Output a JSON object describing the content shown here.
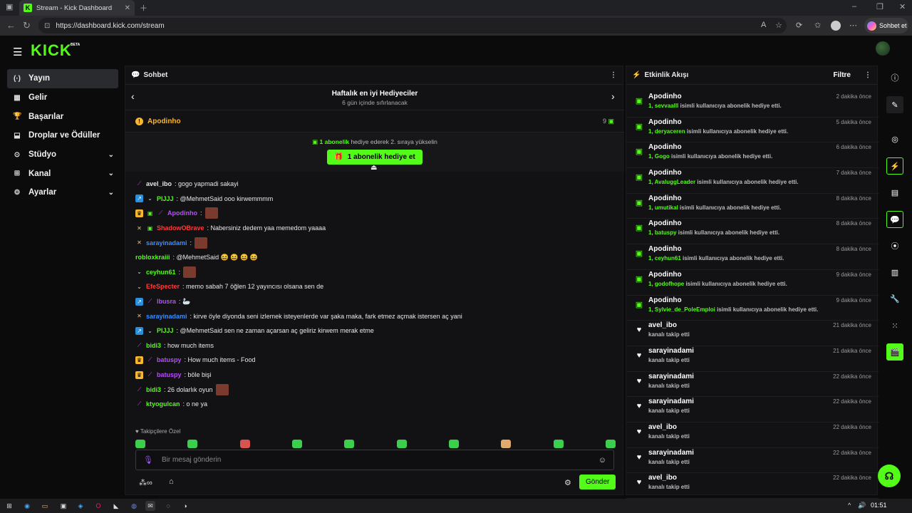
{
  "browser": {
    "tab_title": "Stream - Kick Dashboard",
    "tab_favicon": "K",
    "url": "https://dashboard.kick.com/stream",
    "copilot_label": "Sohbet et"
  },
  "app": {
    "logo": "KICK",
    "logo_badge": "BETA"
  },
  "sidebar": {
    "items": [
      {
        "label": "Yayın",
        "icon": "broadcast-icon",
        "glyph": "(·)"
      },
      {
        "label": "Gelir",
        "icon": "revenue-icon",
        "glyph": "▦"
      },
      {
        "label": "Başarılar",
        "icon": "trophy-icon",
        "glyph": "🏆"
      },
      {
        "label": "Droplar ve Ödüller",
        "icon": "drops-icon",
        "glyph": "⬓"
      },
      {
        "label": "Stüdyo",
        "icon": "studio-icon",
        "glyph": "⊙"
      },
      {
        "label": "Kanal",
        "icon": "channel-icon",
        "glyph": "⊞"
      },
      {
        "label": "Ayarlar",
        "icon": "settings-icon",
        "glyph": "⚙"
      }
    ]
  },
  "chat": {
    "title": "Sohbet",
    "leaderboard_title": "Haftalık en iyi Hediyeciler",
    "leaderboard_sub": "6 gün içinde sıfırlanacak",
    "top_gifter": "Apodinho",
    "top_gifter_count": "9",
    "promo_bold": "1 abonelik",
    "promo_rest": " hediye ederek 2. sıraya yükselin",
    "promo_button": "1 abonelik hediye et",
    "messages": [
      {
        "user": "avel_ibo",
        "color": "#e8e8e8",
        "text": ": gogo yapmadi sakayi",
        "badges": [
          "sword"
        ]
      },
      {
        "user": "PIJJJ",
        "color": "#53fc18",
        "text": ": @MehmetSaid ooo kirwemmmm",
        "badges": [
          "verified",
          "chev"
        ]
      },
      {
        "user": "Apodinho",
        "color": "#b84cff",
        "text": ":",
        "badges": [
          "crown",
          "gift",
          "sword"
        ],
        "emote": true
      },
      {
        "user": "ShadowOBrave",
        "color": "#ff3a3a",
        "text": ": Nabersiniz dedem yaa memedom yaaaa",
        "badges": [
          "swords",
          "gift"
        ]
      },
      {
        "user": "sarayinadami",
        "color": "#3a8dff",
        "text": ":",
        "badges": [
          "swords"
        ],
        "emote": true
      },
      {
        "user": "robloxkraiii",
        "color": "#53fc18",
        "text": ": @MehmetSaid 😆 😆 😆 😆",
        "badges": []
      },
      {
        "user": "ceyhun61",
        "color": "#53fc18",
        "text": ":",
        "badges": [
          "chev"
        ],
        "emote": true
      },
      {
        "user": "EfeSpecter",
        "color": "#ff3a3a",
        "text": ": memo sabah 7 öğlen 12 yayıncısı olsana sen de",
        "badges": [
          "chev"
        ]
      },
      {
        "user": "lbusra",
        "color": "#b84cff",
        "text": ": 🦢",
        "badges": [
          "verified",
          "sword"
        ]
      },
      {
        "user": "sarayinadami",
        "color": "#3a8dff",
        "text": ": kirve öyle diyonda seni izlemek isteyenlerde var şaka maka, fark etmez açmak istersen aç yani",
        "badges": [
          "swords"
        ]
      },
      {
        "user": "PIJJJ",
        "color": "#53fc18",
        "text": ": @MehmetSaid sen ne zaman açarsan aç geliriz kirwem merak etme",
        "badges": [
          "verified",
          "chev"
        ]
      },
      {
        "user": "bidi3",
        "color": "#53fc18",
        "text": ": how much items",
        "badges": [
          "sword"
        ]
      },
      {
        "user": "batuspy",
        "color": "#b84cff",
        "text": ": How much items - Food",
        "badges": [
          "crown",
          "sword"
        ]
      },
      {
        "user": "batuspy",
        "color": "#b84cff",
        "text": ": böle bişi",
        "badges": [
          "crown",
          "sword"
        ]
      },
      {
        "user": "bidi3",
        "color": "#53fc18",
        "text": ": 26 dolarlık oyun",
        "badges": [
          "sword"
        ],
        "emote": true
      },
      {
        "user": "ktyogulcan",
        "color": "#53fc18",
        "text": ": o ne ya",
        "badges": [
          "sword"
        ]
      }
    ],
    "emote_label": "Takipçilere Özel",
    "input_placeholder": "Bir mesaj gönderin",
    "send_button": "Gönder"
  },
  "activity": {
    "title": "Etkinlik Akışı",
    "filter_label": "Filtre",
    "items": [
      {
        "name": "Apodinho",
        "type": "gift",
        "prefix": "1, ",
        "target": "sevvaalll",
        "rest": " isimli kullanıcıya abonelik hediye etti.",
        "time": "2 dakika önce"
      },
      {
        "name": "Apodinho",
        "type": "gift",
        "prefix": "1, ",
        "target": "deryaceren",
        "rest": " isimli kullanıcıya abonelik hediye etti.",
        "time": "5 dakika önce"
      },
      {
        "name": "Apodinho",
        "type": "gift",
        "prefix": "1, ",
        "target": "Gogo",
        "rest": " isimli kullanıcıya abonelik hediye etti.",
        "time": "6 dakika önce"
      },
      {
        "name": "Apodinho",
        "type": "gift",
        "prefix": "1, ",
        "target": "AvaluggLeader",
        "rest": " isimli kullanıcıya abonelik hediye etti.",
        "time": "7 dakika önce"
      },
      {
        "name": "Apodinho",
        "type": "gift",
        "prefix": "1, ",
        "target": "umutikal",
        "rest": " isimli kullanıcıya abonelik hediye etti.",
        "time": "8 dakika önce"
      },
      {
        "name": "Apodinho",
        "type": "gift",
        "prefix": "1, ",
        "target": "batuspy",
        "rest": " isimli kullanıcıya abonelik hediye etti.",
        "time": "8 dakika önce"
      },
      {
        "name": "Apodinho",
        "type": "gift",
        "prefix": "1, ",
        "target": "ceyhun61",
        "rest": " isimli kullanıcıya abonelik hediye etti.",
        "time": "8 dakika önce"
      },
      {
        "name": "Apodinho",
        "type": "gift",
        "prefix": "1, ",
        "target": "godofhope",
        "rest": " isimli kullanıcıya abonelik hediye etti.",
        "time": "9 dakika önce"
      },
      {
        "name": "Apodinho",
        "type": "gift",
        "prefix": "1, ",
        "target": "Sylvie_de_PoleEmploi",
        "rest": " isimli kullanıcıya abonelik hediye etti.",
        "time": "9 dakika önce"
      },
      {
        "name": "avel_ibo",
        "type": "follow",
        "prefix": "",
        "target": "",
        "rest": "kanalı takip etti",
        "time": "21 dakika önce"
      },
      {
        "name": "sarayinadami",
        "type": "follow",
        "prefix": "",
        "target": "",
        "rest": "kanalı takip etti",
        "time": "21 dakika önce"
      },
      {
        "name": "sarayinadami",
        "type": "follow",
        "prefix": "",
        "target": "",
        "rest": "kanalı takip etti",
        "time": "22 dakika önce"
      },
      {
        "name": "sarayinadami",
        "type": "follow",
        "prefix": "",
        "target": "",
        "rest": "kanalı takip etti",
        "time": "22 dakika önce"
      },
      {
        "name": "avel_ibo",
        "type": "follow",
        "prefix": "",
        "target": "",
        "rest": "kanalı takip etti",
        "time": "22 dakika önce"
      },
      {
        "name": "sarayinadami",
        "type": "follow",
        "prefix": "",
        "target": "",
        "rest": "kanalı takip etti",
        "time": "22 dakika önce"
      },
      {
        "name": "avel_ibo",
        "type": "follow",
        "prefix": "",
        "target": "",
        "rest": "kanalı takip etti",
        "time": "22 dakika önce"
      }
    ]
  },
  "taskbar": {
    "clock": "01:51"
  },
  "colors": {
    "accent": "#53fc18",
    "background": "#0b0b0c",
    "panel": "#121214"
  }
}
